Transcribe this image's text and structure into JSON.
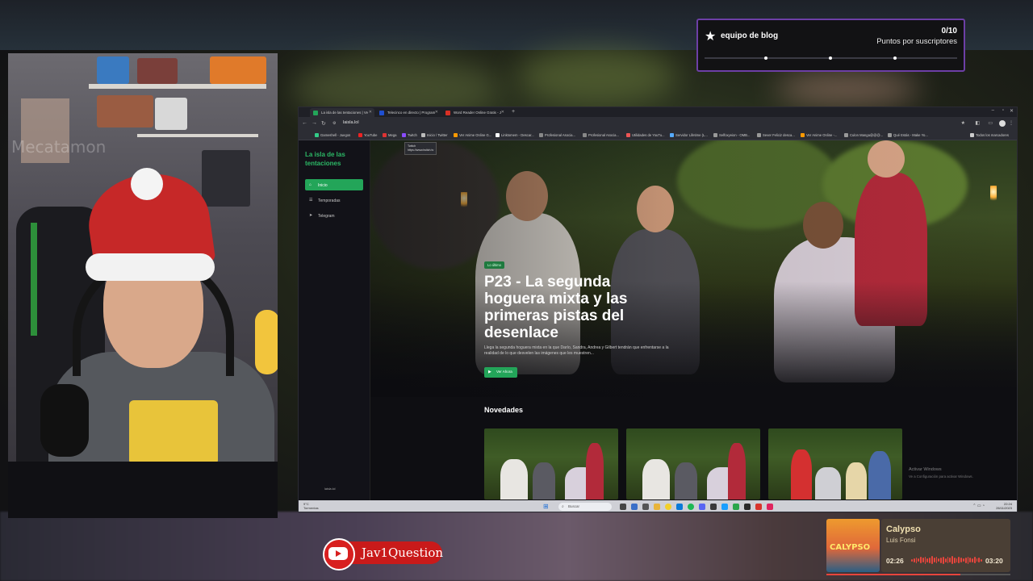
{
  "overlay": {
    "sub_goal": {
      "title": "equipo de blog",
      "count": "0/10",
      "label": "Puntos por suscriptores",
      "progress": 0
    },
    "youtube_badge": {
      "name": "Jav1Question"
    },
    "now_playing": {
      "song": "Calypso",
      "artist": "Luis Fonsi",
      "cover_text": "CALYPSO",
      "current_time": "02:26",
      "total_time": "03:20",
      "progress": 0.73
    },
    "webcam": {
      "watermark": "Mecatamon"
    }
  },
  "browser": {
    "tabs": [
      {
        "label": "La isla de las tentaciones | Ve",
        "active": true,
        "color": "#23a559"
      },
      {
        "label": "Telecinco en directo | Program",
        "active": false,
        "color": "#1f4fd1"
      },
      {
        "label": "Word Reader Online Gratis - J",
        "active": false,
        "color": "#d93025"
      }
    ],
    "url": "laisla.lol",
    "bookmarks": [
      {
        "label": "Gameshell - Juegos",
        "color": "#3c8"
      },
      {
        "label": "YouTube",
        "color": "#e22"
      },
      {
        "label": "Mega",
        "color": "#d33"
      },
      {
        "label": "Twitch",
        "color": "#8a4bff"
      },
      {
        "label": "Inicio / Twitter",
        "color": "#bbb"
      },
      {
        "label": "Ver Anime Online G...",
        "color": "#f90"
      },
      {
        "label": "Linktomem - Descar...",
        "color": "#fff"
      },
      {
        "label": "Profesional Asocia...",
        "color": "#888"
      },
      {
        "label": "Profesional Asocia...",
        "color": "#888"
      },
      {
        "label": "Utilidades de YouTu...",
        "color": "#e55"
      },
      {
        "label": "Servidor Lifetime (L...",
        "color": "#5af"
      },
      {
        "label": "Selfoxyeion - OMB...",
        "color": "#999"
      },
      {
        "label": "Sever Feliciz desca...",
        "color": "#999"
      },
      {
        "label": "Ver Anime Online -...",
        "color": "#f90"
      },
      {
        "label": "Culon Manga@@@...",
        "color": "#999"
      },
      {
        "label": "Qué Estás - Make Yo...",
        "color": "#999"
      },
      {
        "label": "Todos los marcadores",
        "color": "#ccc"
      }
    ],
    "tooltip": {
      "title": "Twitch",
      "url": "https://www.twitch.tv"
    },
    "site": {
      "logo": "La isla de las tentaciones",
      "nav": [
        {
          "label": "Inicio",
          "icon": "home-icon",
          "active": true
        },
        {
          "label": "Temporadas",
          "icon": "list-icon",
          "active": false
        },
        {
          "label": "Telegram",
          "icon": "send-icon",
          "active": false
        }
      ],
      "footer": "laisla.lol",
      "hero": {
        "badge": "Lo último",
        "title": "P23 - La segunda hoguera mixta y las primeras pistas del desenlace",
        "description": "Llega la segunda hoguera mixta en la que Darío, Sandra, Andrea y Gilbert tendrán que enfrentarse a la realidad de lo que desvelen las imágenes que les muestren...",
        "button": "Ver Ahora"
      },
      "section_title": "Novedades"
    },
    "watermark": {
      "title": "Activar Windows",
      "subtitle": "Ve a Configuración para activar Windows."
    },
    "taskbar": {
      "weather_temp": "9°C",
      "weather_desc": "Tormentas",
      "search": "Buscar",
      "time": "22:24",
      "date": "26/11/2023"
    }
  }
}
